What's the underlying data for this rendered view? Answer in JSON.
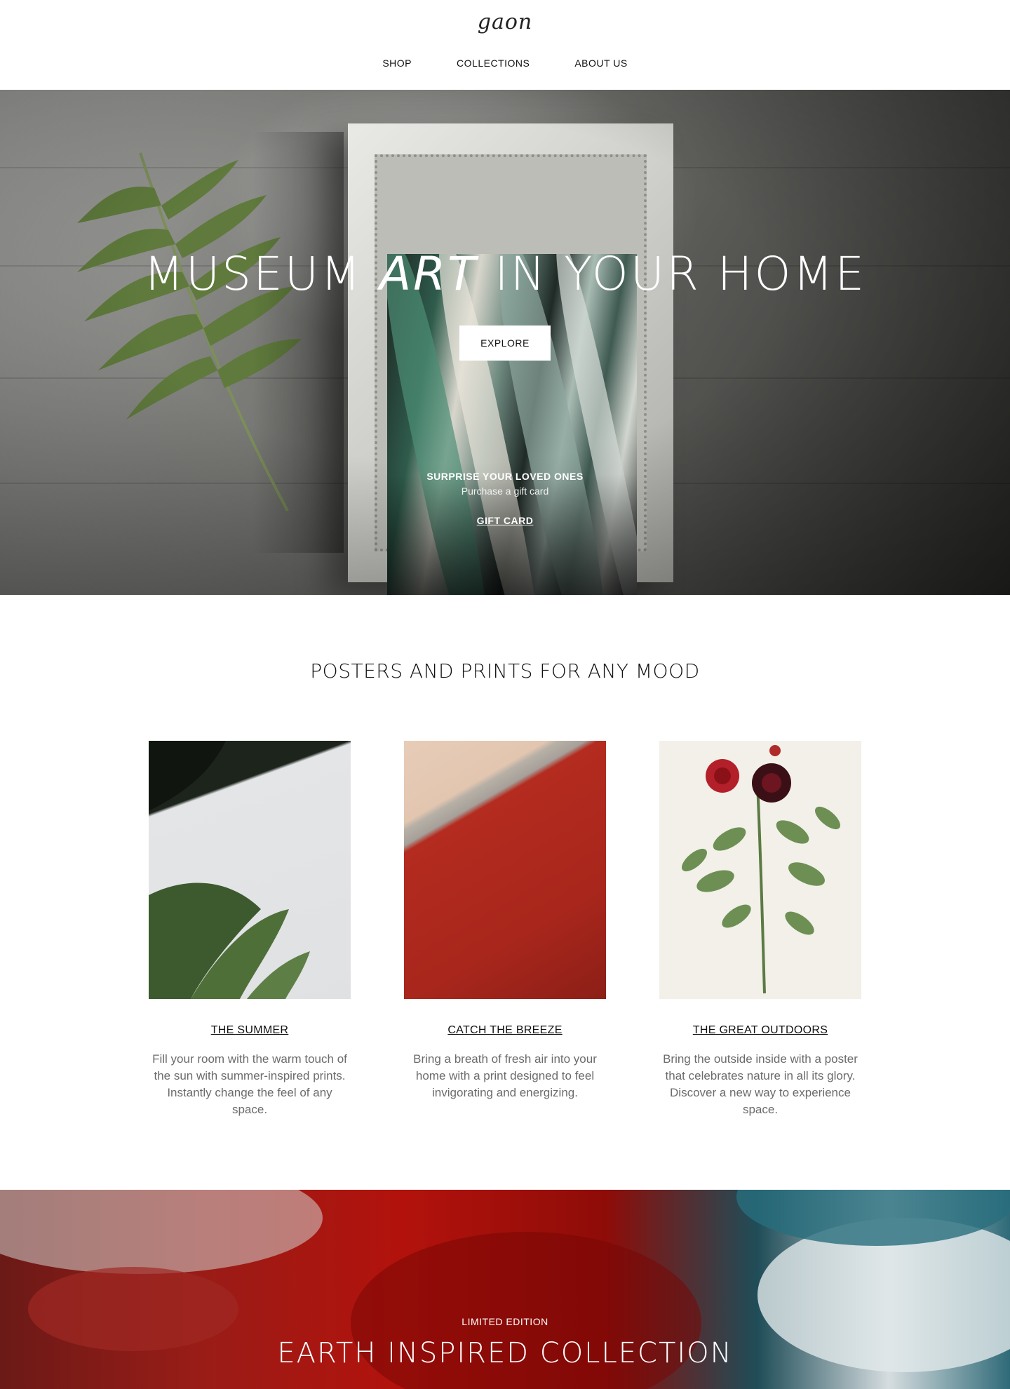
{
  "header": {
    "logo": "gaon",
    "nav": [
      {
        "label": "SHOP"
      },
      {
        "label": "COLLECTIONS"
      },
      {
        "label": "ABOUT US"
      }
    ]
  },
  "hero": {
    "title_part1": "MUSEUM ",
    "title_em": "ART",
    "title_part2": " IN YOUR HOME",
    "cta_label": "EXPLORE",
    "gift_heading": "SURPRISE YOUR LOVED ONES",
    "gift_sub": "Purchase a gift card",
    "gift_link": "GIFT CARD"
  },
  "mood": {
    "title": "POSTERS AND PRINTS FOR ANY MOOD",
    "cards": [
      {
        "title": "THE SUMMER",
        "desc": "Fill your room with the warm touch of the sun with summer-inspired prints. Instantly change the feel of any space."
      },
      {
        "title": "CATCH THE BREEZE",
        "desc": "Bring a breath of fresh air into your home with a print designed to feel invigorating and energizing."
      },
      {
        "title": "THE GREAT OUTDOORS",
        "desc": "Bring the outside inside with a poster that celebrates nature in all its glory. Discover a new way to experience space."
      }
    ]
  },
  "earth": {
    "kicker": "LIMITED EDITION",
    "title": "EARTH INSPIRED COLLECTION"
  },
  "colors": {
    "accent_text": "#111111",
    "muted_text": "#6b6b6b",
    "earth_red": "#b3120c",
    "earth_teal": "#1f4d58"
  }
}
